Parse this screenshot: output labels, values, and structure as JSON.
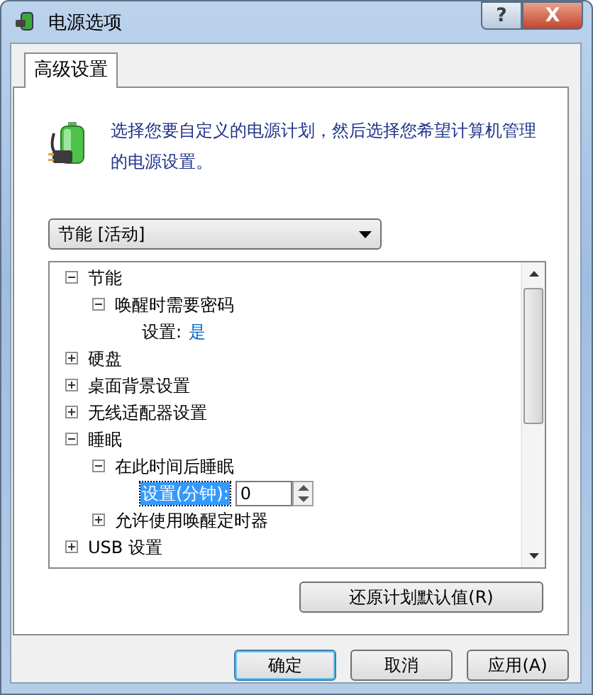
{
  "window": {
    "title": "电源选项",
    "help_button": "?",
    "close_button": "X"
  },
  "tabs": [
    {
      "label": "高级设置",
      "selected": true
    }
  ],
  "description": "选择您要自定义的电源计划，然后选择您希望计算机管理的电源设置。",
  "plan_dropdown": {
    "value": "节能 [活动]"
  },
  "tree": [
    {
      "kind": "group",
      "label": "节能",
      "expanded": true,
      "children": [
        {
          "kind": "group",
          "label": "唤醒时需要密码",
          "expanded": true,
          "children": [
            {
              "kind": "value",
              "label": "设置:",
              "value": "是"
            }
          ]
        }
      ]
    },
    {
      "kind": "group",
      "label": "硬盘",
      "expanded": false
    },
    {
      "kind": "group",
      "label": "桌面背景设置",
      "expanded": false
    },
    {
      "kind": "group",
      "label": "无线适配器设置",
      "expanded": false
    },
    {
      "kind": "group",
      "label": "睡眠",
      "expanded": true,
      "children": [
        {
          "kind": "group",
          "label": "在此时间后睡眠",
          "expanded": true,
          "children": [
            {
              "kind": "spin",
              "label": "设置(分钟):",
              "value": "0",
              "selected": true
            }
          ]
        },
        {
          "kind": "group",
          "label": "允许使用唤醒定时器",
          "expanded": false
        }
      ]
    },
    {
      "kind": "group",
      "label": "USB 设置",
      "expanded": false
    }
  ],
  "restore_button": "还原计划默认值(R)",
  "buttons": [
    {
      "label": "确定",
      "default": true
    },
    {
      "label": "取消",
      "default": false
    },
    {
      "label": "应用(A)",
      "default": false
    }
  ]
}
